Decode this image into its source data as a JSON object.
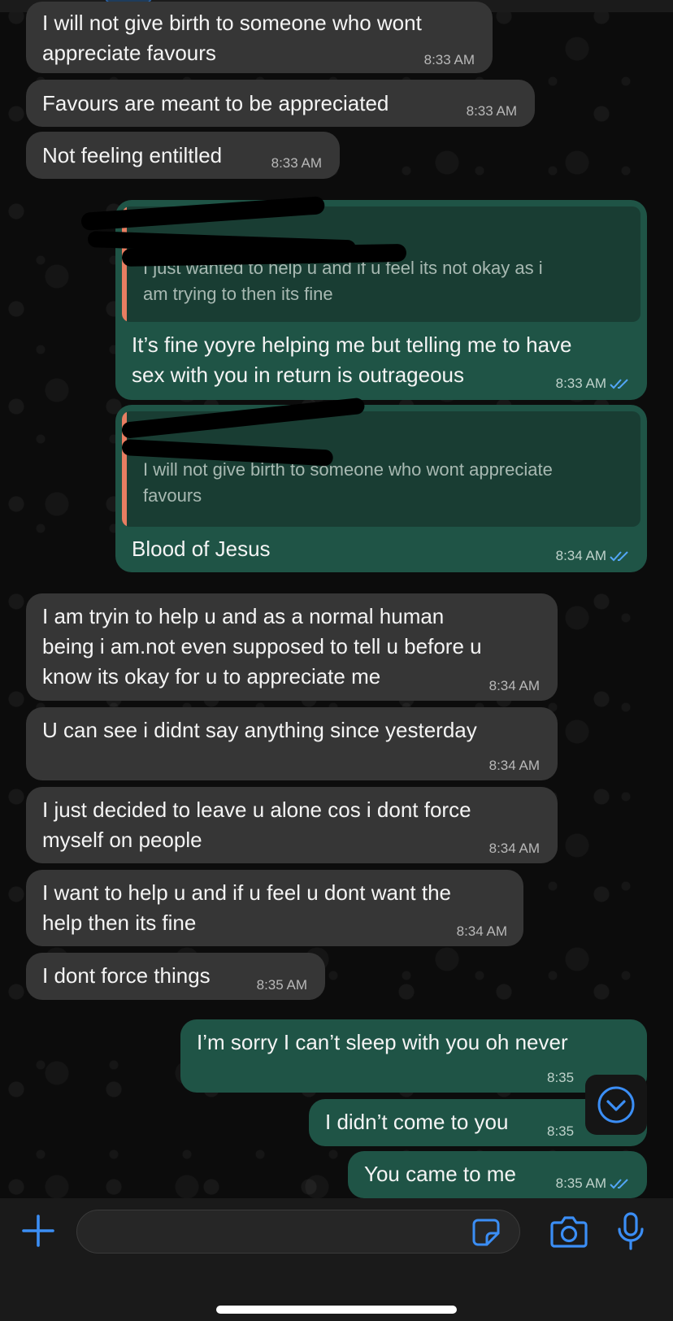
{
  "colors": {
    "incoming_bubble": "#363636",
    "outgoing_bubble": "#1f5446",
    "quote_bar": "#e87e62",
    "read_ticks": "#53a6f7",
    "accent": "#3b8ef5"
  },
  "messages": [
    {
      "direction": "incoming",
      "lines": [
        "I will not give birth to someone who wont",
        "appreciate favours"
      ],
      "time": "8:33 AM"
    },
    {
      "direction": "incoming",
      "lines": [
        "Favours are meant to be appreciated"
      ],
      "time": "8:33 AM"
    },
    {
      "direction": "incoming",
      "lines": [
        "Not feeling entiltled"
      ],
      "time": "8:33 AM"
    },
    {
      "direction": "outgoing",
      "quote": {
        "lines": [
          "I just wanted to help u and if u feel its not okay as i",
          "am trying to then its fine"
        ]
      },
      "lines": [
        "It’s fine yoyre helping me but telling me to have",
        "sex with you in return is outrageous"
      ],
      "time": "8:33 AM",
      "status": "read"
    },
    {
      "direction": "outgoing",
      "quote": {
        "lines": [
          "I will not give birth to someone who wont appreciate",
          "favours"
        ]
      },
      "lines": [
        "Blood of Jesus"
      ],
      "time": "8:34 AM",
      "status": "read"
    },
    {
      "direction": "incoming",
      "lines": [
        "I am tryin to help u and as a normal human",
        "being i am.not even supposed to tell u before u",
        "know its okay for u to appreciate me"
      ],
      "time": "8:34 AM"
    },
    {
      "direction": "incoming",
      "lines": [
        "U can see i didnt say anything since yesterday"
      ],
      "time": "8:34 AM"
    },
    {
      "direction": "incoming",
      "lines": [
        "I just decided to leave u alone cos i dont force",
        "myself on people"
      ],
      "time": "8:34 AM"
    },
    {
      "direction": "incoming",
      "lines": [
        "I want to help u and if u feel u dont want the",
        "help then its fine"
      ],
      "time": "8:34 AM"
    },
    {
      "direction": "incoming",
      "lines": [
        "I dont force things"
      ],
      "time": "8:35 AM"
    },
    {
      "direction": "outgoing",
      "lines": [
        "I’m sorry I can’t sleep with you oh never"
      ],
      "time": "8:35",
      "status": "obscured"
    },
    {
      "direction": "outgoing",
      "lines": [
        "I didn’t come to you"
      ],
      "time": "8:35",
      "status": "obscured"
    },
    {
      "direction": "outgoing",
      "lines": [
        "You came to me"
      ],
      "time": "8:35 AM",
      "status": "read"
    }
  ],
  "scroll_button": {
    "icon": "chevron-down-circle-icon"
  },
  "composer": {
    "attach_icon": "plus-icon",
    "input_value": "",
    "sticker_icon": "sticker-icon",
    "camera_icon": "camera-icon",
    "mic_icon": "microphone-icon"
  }
}
